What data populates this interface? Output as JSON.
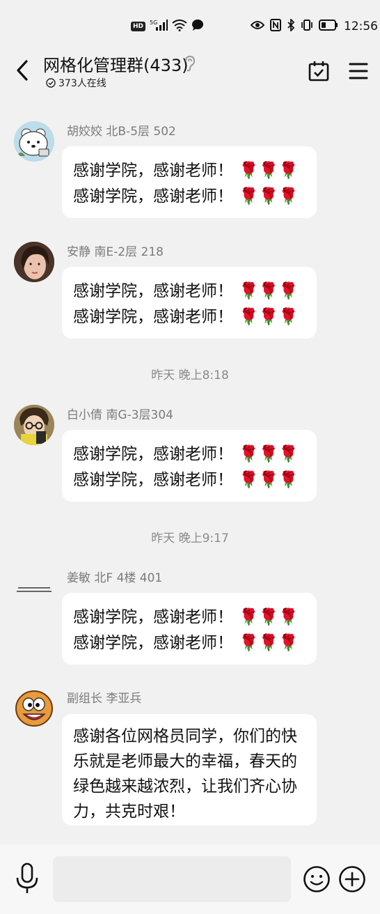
{
  "status_bar": {
    "hd": "HD",
    "signal": "5G",
    "time": "12:56"
  },
  "header": {
    "title": "网格化管理群(433)",
    "online": "373人在线"
  },
  "messages": [
    {
      "sender": "胡姣姣 北B-5层 502",
      "lines": [
        "感谢学院，感谢老师！",
        "感谢学院，感谢老师！"
      ],
      "roses": "🌹🌹🌹"
    },
    {
      "sender": "安静 南E-2层 218",
      "lines": [
        "感谢学院，感谢老师！",
        "感谢学院，感谢老师！"
      ],
      "roses": "🌹🌹🌹"
    },
    {
      "sender": "白小倩  南G-3层304",
      "lines": [
        "感谢学院，感谢老师！",
        "感谢学院，感谢老师！"
      ],
      "roses": "🌹🌹🌹"
    },
    {
      "sender": "姜敏 北F 4楼 401",
      "lines": [
        "感谢学院，感谢老师！",
        "感谢学院，感谢老师！"
      ],
      "roses": "🌹🌹🌹"
    },
    {
      "sender": "副组长 李亚兵",
      "text": "感谢各位网格员同学，你们的快乐就是老师最大的幸福，春天的绿色越来越浓烈，让我们齐心协力，共克时艰！"
    }
  ],
  "time_separators": [
    "昨天 晚上8:18",
    "昨天 晚上9:17"
  ],
  "input": {
    "placeholder": ""
  },
  "colors": {
    "background": "#f1f1f1",
    "bubble": "#ffffff",
    "sender": "#7b7b7b",
    "rose": "#d8282e"
  }
}
